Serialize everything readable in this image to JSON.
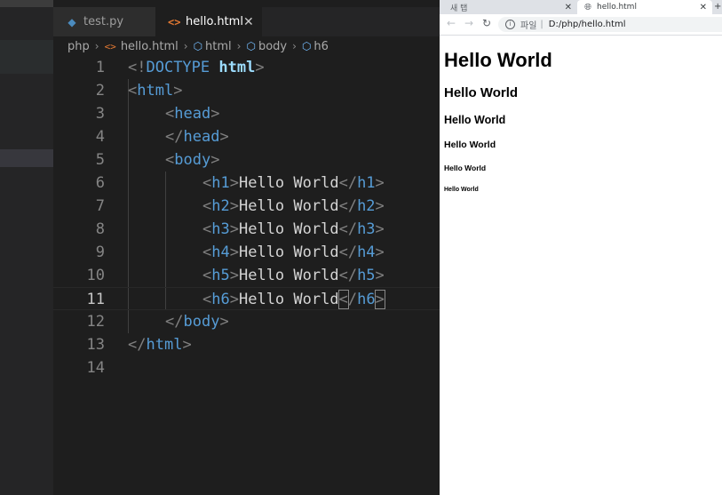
{
  "editor": {
    "tabs": [
      {
        "label": "test.py",
        "icon": "python-icon"
      },
      {
        "label": "hello.html",
        "icon": "html-icon",
        "close": "✕"
      }
    ],
    "breadcrumb": [
      "php",
      "hello.html",
      "html",
      "body",
      "h6"
    ],
    "line_numbers": [
      "1",
      "2",
      "3",
      "4",
      "5",
      "6",
      "7",
      "8",
      "9",
      "10",
      "11",
      "12",
      "13",
      "14"
    ],
    "active_line": "11",
    "code": {
      "l1": {
        "open": "<!",
        "doctype": "DOCTYPE",
        "space": " ",
        "word": "html",
        "close": ">"
      },
      "l2": {
        "open": "<",
        "tag": "html",
        "close": ">"
      },
      "l3": {
        "open": "<",
        "tag": "head",
        "close": ">"
      },
      "l4": {
        "open": "</",
        "tag": "head",
        "close": ">"
      },
      "l5": {
        "open": "<",
        "tag": "body",
        "close": ">"
      },
      "headings": [
        {
          "tag": "h1",
          "text": "Hello World"
        },
        {
          "tag": "h2",
          "text": "Hello World"
        },
        {
          "tag": "h3",
          "text": "Hello World"
        },
        {
          "tag": "h4",
          "text": "Hello World"
        },
        {
          "tag": "h5",
          "text": "Hello World"
        },
        {
          "tag": "h6",
          "text": "Hello World"
        }
      ],
      "l12": {
        "open": "</",
        "tag": "body",
        "close": ">"
      },
      "l13": {
        "open": "</",
        "tag": "html",
        "close": ">"
      }
    }
  },
  "browser": {
    "tabs": [
      {
        "label": "새 탭",
        "close": "✕"
      },
      {
        "label": "hello.html",
        "close": "✕"
      }
    ],
    "new_tab": "+",
    "address": {
      "scheme": "파일",
      "separator": "|",
      "url": "D:/php/hello.html"
    },
    "page": {
      "h1": "Hello World",
      "h2": "Hello World",
      "h3": "Hello World",
      "h4": "Hello World",
      "h5": "Hello World",
      "h6": "Hello World"
    }
  },
  "colors": {
    "editor_bg": "#1e1e1e",
    "tag_blue": "#569cd6",
    "punctuation": "#808080",
    "text": "#d4d4d4"
  }
}
